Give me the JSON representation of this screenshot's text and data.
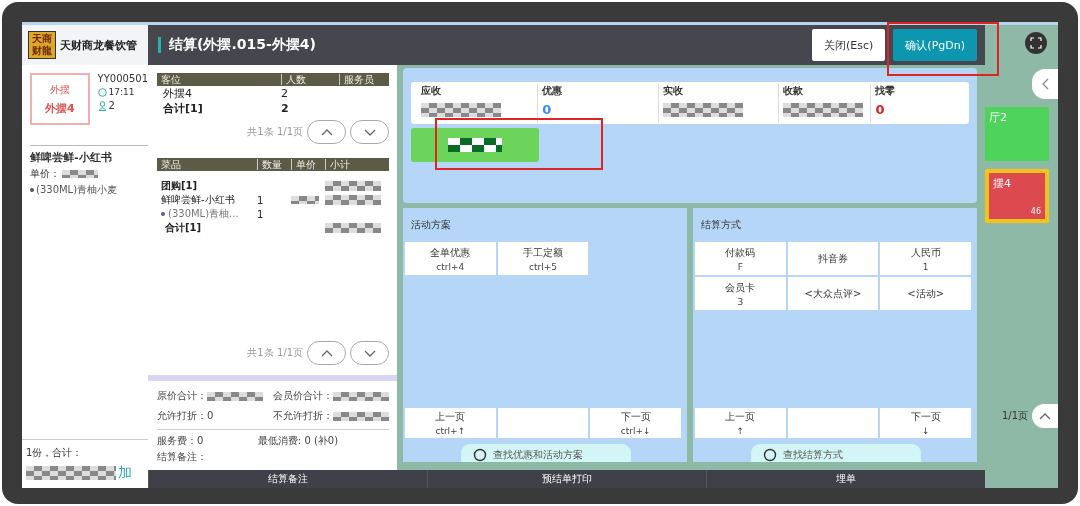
{
  "background_app": {
    "logo": [
      "天商",
      "财龍"
    ],
    "title": "天财商龙餐饮管",
    "table_card": {
      "area": "外摆",
      "name": "外摆4"
    },
    "order_no": "YY000501",
    "time": "17:11",
    "guests": "2",
    "item": {
      "name": "鲜啤尝鲜-小红书",
      "price_label": "单价：",
      "option": "(330ML)青柚小麦"
    },
    "footer_total": "1份，合计：",
    "add_label": "加",
    "right_tiles": [
      {
        "name": "厅2",
        "kind": "green"
      },
      {
        "name": "摆4",
        "count": "46",
        "kind": "red"
      }
    ],
    "right_pager": "1/1页"
  },
  "dialog": {
    "title": "结算(外摆.015-外摆4)",
    "buttons": [
      {
        "label": "关闭(Esc)",
        "kind": "close"
      },
      {
        "label": "确认(PgDn)",
        "kind": "confirm"
      }
    ],
    "seats": {
      "columns": [
        "客位",
        "人数",
        "服务员"
      ],
      "rows": [
        {
          "seat": "外摆4",
          "count": "2",
          "kind": "row"
        },
        {
          "seat": "合计[1]",
          "count": "2",
          "kind": "total"
        }
      ],
      "pager": "共1条 1/1页"
    },
    "dishes": {
      "columns": [
        "菜品",
        "数量",
        "单价",
        "小计"
      ],
      "rows": [
        {
          "name": "团购[1]",
          "kind": "group"
        },
        {
          "name": "鲜啤尝鲜-小红书",
          "qty": "1",
          "kind": "item"
        },
        {
          "name": "(330ML)青柚...",
          "qty": "1",
          "kind": "option"
        },
        {
          "name": "合计[1]",
          "kind": "total"
        }
      ],
      "pager": "共1条 1/1页"
    },
    "summary": [
      {
        "label": "原价合计："
      },
      {
        "label": "会员价合计："
      },
      {
        "label": "允许打折：0"
      },
      {
        "label": "不允许打折："
      }
    ],
    "extras": [
      "服务费：0",
      "最低消费: 0 (补0)",
      "结算备注："
    ],
    "amounts": [
      {
        "label": "应收",
        "kind": "hidden"
      },
      {
        "label": "优惠",
        "value": "0",
        "kind": "blue"
      },
      {
        "label": "实收",
        "kind": "hidden"
      },
      {
        "label": "收款",
        "kind": "hidden"
      },
      {
        "label": "找零",
        "value": "0",
        "kind": "red"
      }
    ],
    "panels": [
      {
        "title": "活动方案",
        "options": [
          {
            "name": "全单优惠",
            "key": "ctrl+4"
          },
          {
            "name": "手工定额",
            "key": "ctrl+5"
          }
        ],
        "prev": {
          "name": "上一页",
          "key": "ctrl+↑"
        },
        "next": {
          "name": "下一页",
          "key": "ctrl+↓"
        },
        "search": "查找优惠和活动方案"
      },
      {
        "title": "结算方式",
        "options": [
          {
            "name": "付款码",
            "key": "F"
          },
          {
            "name": "抖音券"
          },
          {
            "name": "人民币",
            "key": "1"
          },
          {
            "name": "会员卡",
            "key": "3"
          },
          {
            "name": "<大众点评>"
          },
          {
            "name": "<活动>"
          }
        ],
        "prev": {
          "name": "上一页",
          "key": "↑"
        },
        "next": {
          "name": "下一页",
          "key": "↓"
        },
        "search": "查找结算方式"
      }
    ],
    "footer": [
      "结算备注",
      "预结单打印",
      "埋单"
    ]
  }
}
